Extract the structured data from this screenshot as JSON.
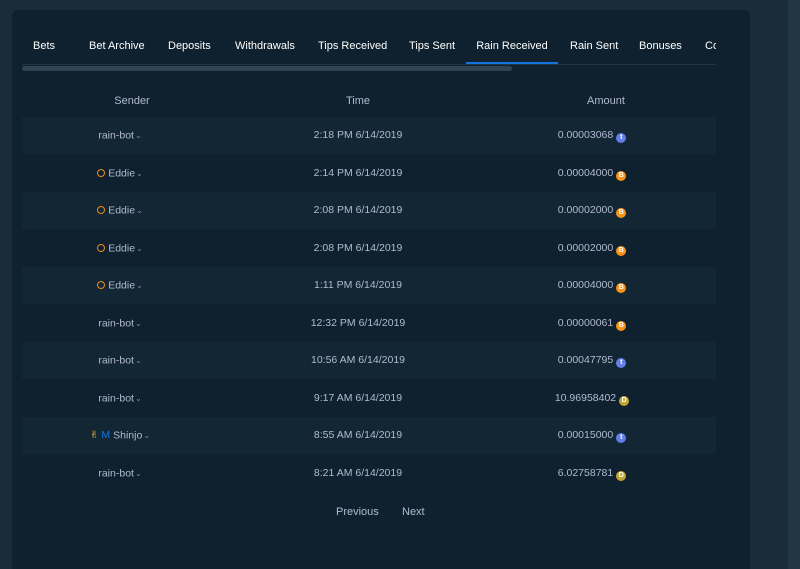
{
  "tabs": [
    {
      "label": "Bets"
    },
    {
      "label": "Bet Archive"
    },
    {
      "label": "Deposits"
    },
    {
      "label": "Withdrawals"
    },
    {
      "label": "Tips Received"
    },
    {
      "label": "Tips Sent"
    },
    {
      "label": "Rain Received"
    },
    {
      "label": "Rain Sent"
    },
    {
      "label": "Bonuses"
    },
    {
      "label": "Coupons"
    }
  ],
  "active_tab": "Rain Received",
  "columns": {
    "sender": "Sender",
    "time": "Time",
    "amount": "Amount"
  },
  "rows": [
    {
      "sender": "rain-bot",
      "badge": "none",
      "time": "2:18 PM 6/14/2019",
      "amount": "0.00003068",
      "currency_icon": "eth-icon"
    },
    {
      "sender": "Eddie",
      "badge": "ring",
      "time": "2:14 PM 6/14/2019",
      "amount": "0.00004000",
      "currency_icon": "btc-icon"
    },
    {
      "sender": "Eddie",
      "badge": "ring",
      "time": "2:08 PM 6/14/2019",
      "amount": "0.00002000",
      "currency_icon": "btc-icon"
    },
    {
      "sender": "Eddie",
      "badge": "ring",
      "time": "2:08 PM 6/14/2019",
      "amount": "0.00002000",
      "currency_icon": "btc-icon"
    },
    {
      "sender": "Eddie",
      "badge": "ring",
      "time": "1:11 PM 6/14/2019",
      "amount": "0.00004000",
      "currency_icon": "btc-icon"
    },
    {
      "sender": "rain-bot",
      "badge": "none",
      "time": "12:32 PM 6/14/2019",
      "amount": "0.00000061",
      "currency_icon": "btc-icon"
    },
    {
      "sender": "rain-bot",
      "badge": "none",
      "time": "10:56 AM 6/14/2019",
      "amount": "0.00047795",
      "currency_icon": "eth-icon"
    },
    {
      "sender": "rain-bot",
      "badge": "none",
      "time": "9:17 AM 6/14/2019",
      "amount": "10.96958402",
      "currency_icon": "doge-icon"
    },
    {
      "sender": "Shinjo",
      "badge": "hand-m",
      "time": "8:55 AM 6/14/2019",
      "amount": "0.00015000",
      "currency_icon": "eth-icon"
    },
    {
      "sender": "rain-bot",
      "badge": "none",
      "time": "8:21 AM 6/14/2019",
      "amount": "6.02758781",
      "currency_icon": "doge-icon"
    }
  ],
  "pagination": {
    "previous": "Previous",
    "next": "Next"
  },
  "badge_text": {
    "m": "M"
  },
  "colors": {
    "background": "#1a2c38",
    "panel": "#0f212e",
    "accent": "#1475e1",
    "eth": "#627eea",
    "btc": "#f7931a",
    "doge": "#c2a633",
    "ring": "#ed8b1a"
  }
}
